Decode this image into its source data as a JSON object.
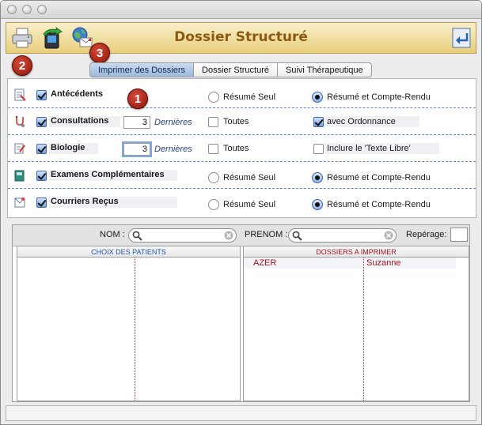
{
  "app": {
    "title": "Dossier Structuré"
  },
  "colors": {
    "badge": "#b8231a",
    "title": "#8b5a10",
    "toolbar": "#e8cf7c",
    "active_tab": "#9db8db",
    "separator": "#5d87c5"
  },
  "toolbar": {
    "buttons": [
      {
        "name": "print-icon"
      },
      {
        "name": "transfer-device-icon"
      },
      {
        "name": "globe-letter-icon"
      }
    ],
    "right_button": {
      "name": "exit-doc-icon"
    }
  },
  "badges": [
    "1",
    "2",
    "3"
  ],
  "tabs": [
    "Imprimer des Dossiers",
    "Dossier Structuré",
    "Suivi Thérapeutique"
  ],
  "active_tab": 0,
  "sections": {
    "antecedents": {
      "label": "Antécédents",
      "checked": true,
      "opt1": "Résumé Seul",
      "opt2": "Résumé et Compte-Rendu",
      "selected": 2
    },
    "consultations": {
      "label": "Consultations",
      "checked": true,
      "count": "3",
      "dernieres": "Dernières",
      "toutes": "Toutes",
      "toutes_checked": false,
      "extra": "avec Ordonnance",
      "extra_checked": true
    },
    "biologie": {
      "label": "Biologie",
      "checked": true,
      "count": "3",
      "dernieres": "Dernières",
      "toutes": "Toutes",
      "toutes_checked": false,
      "extra": "Inclure le 'Texte Libre'",
      "extra_checked": false
    },
    "examens": {
      "label": "Examens Complémentaires",
      "checked": true,
      "opt1": "Résumé Seul",
      "opt2": "Résumé et Compte-Rendu",
      "selected": 2
    },
    "courriers": {
      "label": "Courriers Reçus",
      "checked": true,
      "opt1": "Résumé Seul",
      "opt2": "Résumé et Compte-Rendu",
      "selected": 2
    }
  },
  "search": {
    "nom_label": "NOM :",
    "nom_value": "",
    "prenom_label": "PRENOM :",
    "prenom_value": "",
    "reperage_label": "Repérage:",
    "reperage_value": ""
  },
  "lists": {
    "left_header": "CHOIX DES PATIENTS",
    "right_header": "DOSSIERS A IMPRIMER",
    "left_rows": [],
    "right_rows": [
      {
        "nom": "AZER",
        "prenom": "Suzanne"
      }
    ]
  }
}
